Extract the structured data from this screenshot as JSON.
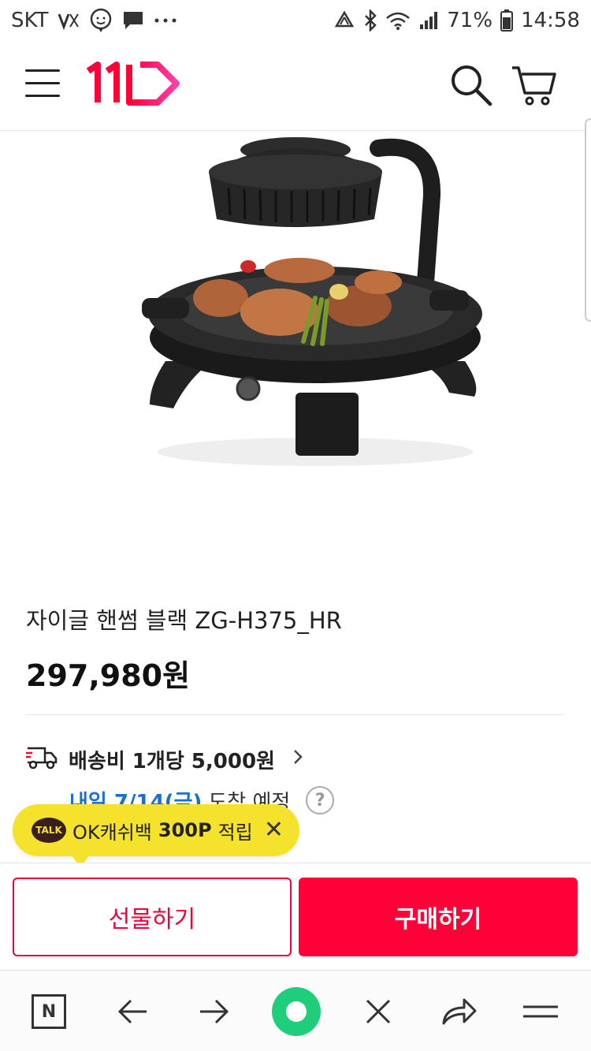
{
  "status_bar": {
    "carrier": "SKT",
    "battery": "71%",
    "time": "14:58"
  },
  "header": {
    "logo_text": "11번가"
  },
  "product": {
    "title": "자이글 핸썸 블랙 ZG-H375_HR",
    "price": "297,980원"
  },
  "shipping": {
    "fee_text": "배송비 1개당 5,000원",
    "delivery_date": "내일 7/14(금)",
    "delivery_suffix": "도착 예정",
    "help_symbol": "?"
  },
  "kakao_tooltip": {
    "badge": "TALK",
    "prefix": "OK캐쉬백",
    "points": "300P",
    "suffix": "적립",
    "close": "✕"
  },
  "actions": {
    "gift_label": "선물하기",
    "buy_label": "구매하기"
  },
  "browser_nav": {
    "n_label": "N"
  },
  "colors": {
    "accent_red": "#ff0038",
    "accent_green": "#1fce7a",
    "delivery_blue": "#1a6fd6",
    "kakao_yellow": "#f5e22d"
  }
}
